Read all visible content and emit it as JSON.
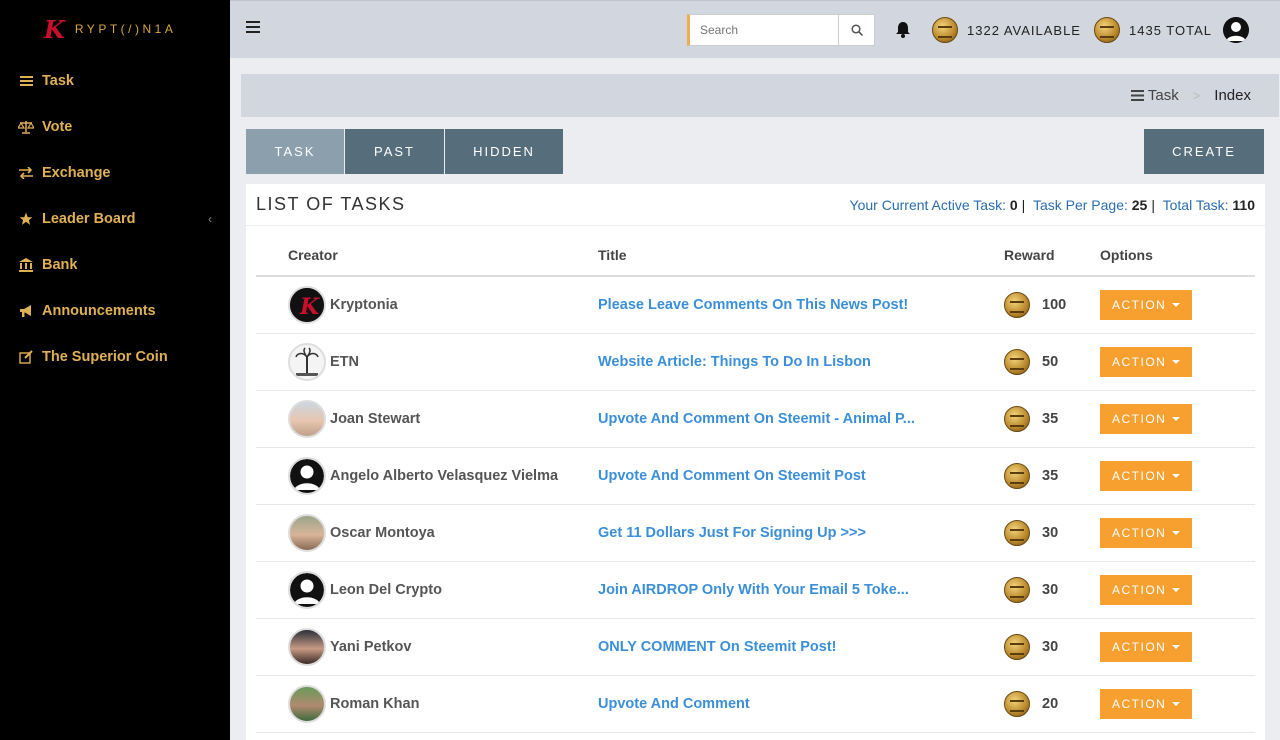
{
  "brand": {
    "k": "K",
    "text": "RYPT(/)N1A"
  },
  "sidebar": {
    "items": [
      {
        "label": "Task",
        "icon": "list-icon"
      },
      {
        "label": "Vote",
        "icon": "scale-icon"
      },
      {
        "label": "Exchange",
        "icon": "exchange-icon"
      },
      {
        "label": "Leader Board",
        "icon": "star-icon",
        "has_caret": true
      },
      {
        "label": "Bank",
        "icon": "bank-icon"
      },
      {
        "label": "Announcements",
        "icon": "bullhorn-icon"
      },
      {
        "label": "The Superior Coin",
        "icon": "edit-icon"
      }
    ]
  },
  "topbar": {
    "search_placeholder": "Search",
    "available": "1322 AVAILABLE",
    "total": "1435 TOTAL"
  },
  "breadcrumb": {
    "parent": "Task",
    "current": "Index"
  },
  "tabs": [
    {
      "label": "TASK",
      "active": true
    },
    {
      "label": "PAST"
    },
    {
      "label": "HIDDEN"
    }
  ],
  "create_label": "CREATE",
  "panel": {
    "title": "LIST OF TASKS",
    "active_label": "Your Current Active Task:",
    "active_value": "0",
    "per_page_label": "Task Per Page:",
    "per_page_value": "25",
    "total_label": "Total Task:",
    "total_value": "110"
  },
  "table": {
    "headers": {
      "creator": "Creator",
      "title": "Title",
      "reward": "Reward",
      "options": "Options"
    },
    "action_label": "ACTION",
    "rows": [
      {
        "creator": "Kryptonia",
        "title": "Please Leave Comments On This News Post!",
        "reward": "100",
        "avatar": "kryptonia-logo"
      },
      {
        "creator": "ETN",
        "title": "Website Article: Things To Do In Lisbon",
        "reward": "50",
        "avatar": "palm-tree"
      },
      {
        "creator": "Joan Stewart",
        "title": "Upvote And Comment On Steemit - Animal P...",
        "reward": "35",
        "avatar": "photo"
      },
      {
        "creator": "Angelo Alberto Velasquez Vielma",
        "title": "Upvote And Comment On Steemit Post",
        "reward": "35",
        "avatar": "default"
      },
      {
        "creator": "Oscar Montoya",
        "title": "Get 11 Dollars Just For Signing Up >>>",
        "reward": "30",
        "avatar": "photo"
      },
      {
        "creator": "Leon Del Crypto",
        "title": "Join AIRDROP Only With Your Email 5 Toke...",
        "reward": "30",
        "avatar": "default"
      },
      {
        "creator": "Yani Petkov",
        "title": "ONLY COMMENT On Steemit Post!",
        "reward": "30",
        "avatar": "photo"
      },
      {
        "creator": "Roman Khan",
        "title": "Upvote And Comment",
        "reward": "20",
        "avatar": "photo"
      }
    ]
  },
  "colors": {
    "sidebar_bg": "#000000",
    "sidebar_text": "#e0b054",
    "tab_bg": "#566d7c",
    "tab_active_bg": "#8ba0ac",
    "action_orange": "#f7a030",
    "link_blue": "#3b8fd9"
  }
}
